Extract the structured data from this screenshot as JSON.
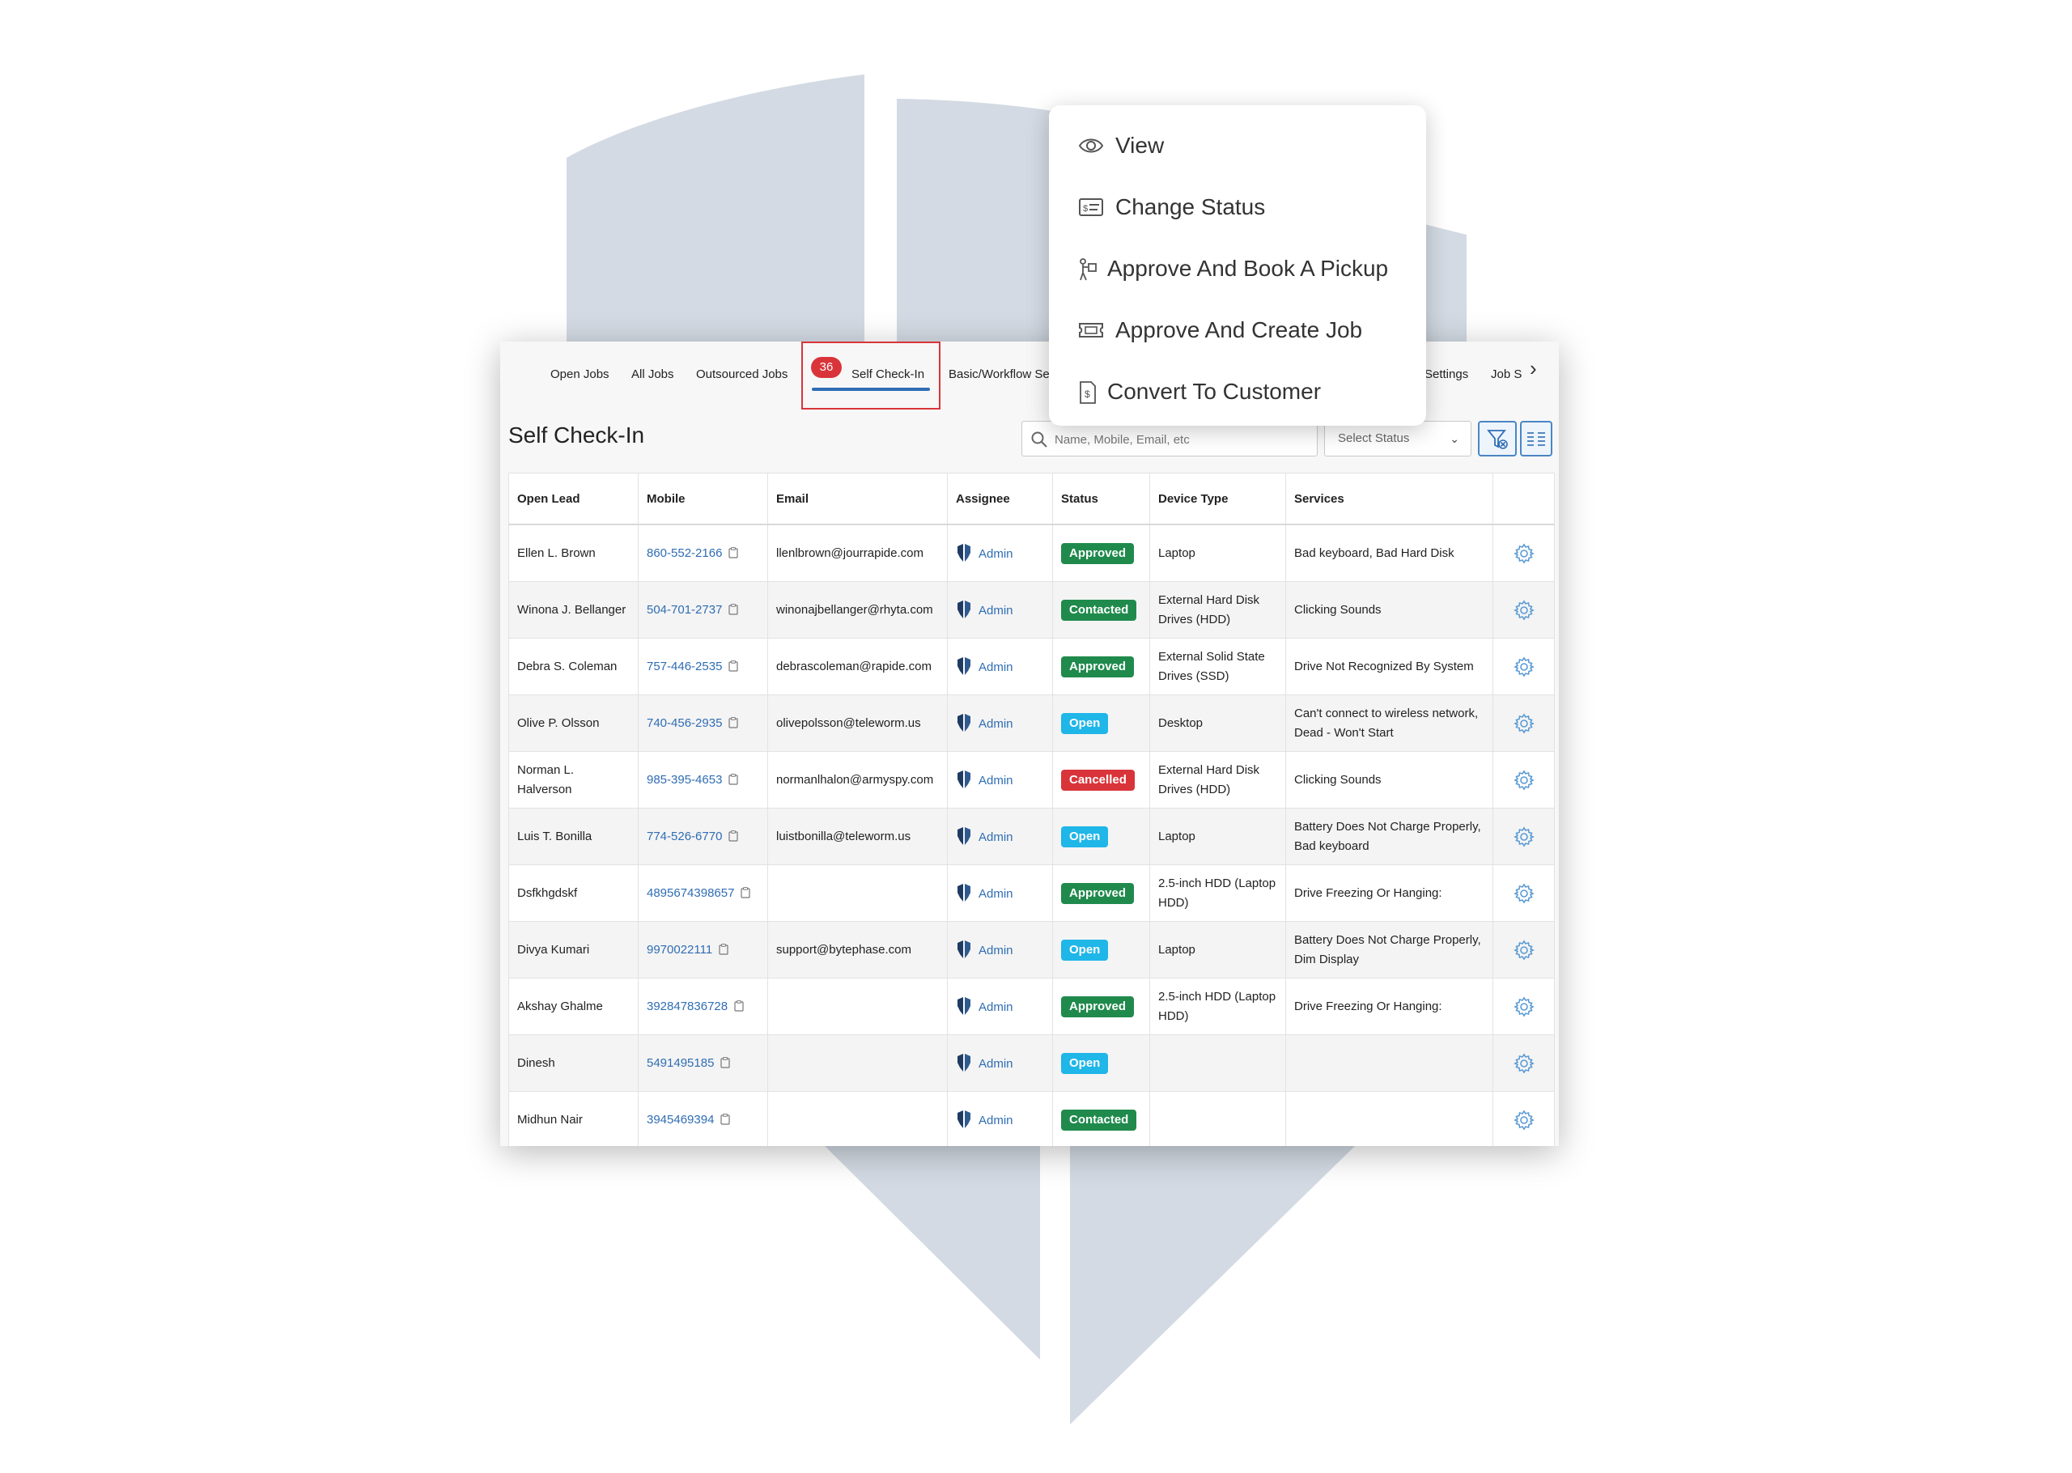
{
  "tabs": [
    {
      "label": "Open Jobs"
    },
    {
      "label": "All Jobs"
    },
    {
      "label": "Outsourced Jobs"
    },
    {
      "label": "Self Check-In",
      "badge": "36",
      "active": true
    },
    {
      "label": "Basic/Workflow Se"
    },
    {
      "label": "Settings"
    },
    {
      "label": "Job S"
    }
  ],
  "page": {
    "title": "Self Check-In",
    "search_placeholder": "Name, Mobile, Email, etc",
    "status_select": "Select Status"
  },
  "table": {
    "columns": [
      "Open Lead",
      "Mobile",
      "Email",
      "Assignee",
      "Status",
      "Device Type",
      "Services",
      ""
    ],
    "rows": [
      {
        "lead": "Ellen L. Brown",
        "mobile": "860-552-2166",
        "email": "llenlbrown@jourrapide.com",
        "assignee": "Admin",
        "status": "Approved",
        "device": "Laptop",
        "services": "Bad keyboard, Bad Hard Disk"
      },
      {
        "lead": "Winona J. Bellanger",
        "mobile": "504-701-2737",
        "email": "winonajbellanger@rhyta.com",
        "assignee": "Admin",
        "status": "Contacted",
        "device": "External Hard Disk Drives (HDD)",
        "services": "Clicking Sounds"
      },
      {
        "lead": "Debra S. Coleman",
        "mobile": "757-446-2535",
        "email": "debrascoleman@rapide.com",
        "assignee": "Admin",
        "status": "Approved",
        "device": "External Solid State Drives (SSD)",
        "services": "Drive Not Recognized By System"
      },
      {
        "lead": "Olive P. Olsson",
        "mobile": "740-456-2935",
        "email": "olivepolsson@teleworm.us",
        "assignee": "Admin",
        "status": "Open",
        "device": "Desktop",
        "services": "Can't connect to wireless network, Dead - Won't Start"
      },
      {
        "lead": "Norman L. Halverson",
        "mobile": "985-395-4653",
        "email": "normanlhalon@armyspy.com",
        "assignee": "Admin",
        "status": "Cancelled",
        "device": "External Hard Disk Drives (HDD)",
        "services": "Clicking Sounds"
      },
      {
        "lead": "Luis T. Bonilla",
        "mobile": "774-526-6770",
        "email": "luistbonilla@teleworm.us",
        "assignee": "Admin",
        "status": "Open",
        "device": "Laptop",
        "services": "Battery Does Not Charge Properly, Bad keyboard"
      },
      {
        "lead": "Dsfkhgdskf",
        "mobile": "4895674398657",
        "email": "",
        "assignee": "Admin",
        "status": "Approved",
        "device": "2.5-inch HDD (Laptop HDD)",
        "services": "Drive Freezing Or Hanging:"
      },
      {
        "lead": "Divya Kumari",
        "mobile": "9970022111",
        "email": "support@bytephase.com",
        "assignee": "Admin",
        "status": "Open",
        "device": "Laptop",
        "services": "Battery Does Not Charge Properly, Dim Display"
      },
      {
        "lead": "Akshay Ghalme",
        "mobile": "392847836728",
        "email": "",
        "assignee": "Admin",
        "status": "Approved",
        "device": "2.5-inch HDD (Laptop HDD)",
        "services": "Drive Freezing Or Hanging:"
      },
      {
        "lead": "Dinesh",
        "mobile": "5491495185",
        "email": "",
        "assignee": "Admin",
        "status": "Open",
        "device": "",
        "services": ""
      },
      {
        "lead": "Midhun Nair",
        "mobile": "3945469394",
        "email": "",
        "assignee": "Admin",
        "status": "Contacted",
        "device": "",
        "services": ""
      }
    ]
  },
  "context_menu": {
    "items": [
      {
        "label": "View",
        "icon": "eye-icon"
      },
      {
        "label": "Change Status",
        "icon": "status-card-icon"
      },
      {
        "label": "Approve And Book A Pickup",
        "icon": "pickup-person-icon"
      },
      {
        "label": "Approve And Create Job",
        "icon": "ticket-icon"
      },
      {
        "label": "Convert To Customer",
        "icon": "invoice-icon"
      }
    ]
  },
  "colors": {
    "accent": "#2f6db3",
    "approved": "#1f8a4c",
    "open": "#1fb6e8",
    "cancelled": "#d9343a",
    "badge": "#d9343a",
    "background_shield": "#d3dae3"
  }
}
